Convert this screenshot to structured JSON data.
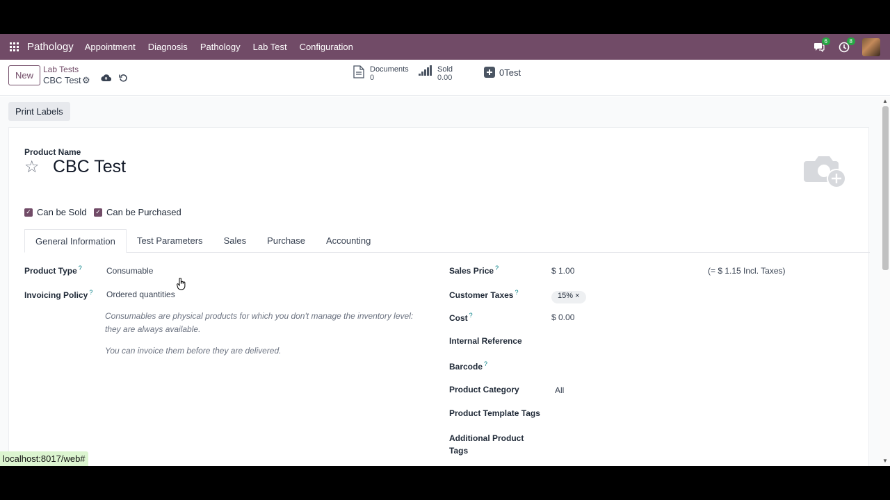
{
  "navbar": {
    "brand": "Pathology",
    "menu": [
      "Appointment",
      "Diagnosis",
      "Pathology",
      "Lab Test",
      "Configuration"
    ],
    "messages_badge": "6",
    "activities_badge": "8"
  },
  "control_panel": {
    "new_label": "New",
    "breadcrumb": "Lab Tests",
    "record_title": "CBC Test",
    "documents": {
      "label": "Documents",
      "value": "0"
    },
    "sold": {
      "label": "Sold",
      "value": "0.00"
    },
    "test_button": "0Test"
  },
  "actions": {
    "print_labels": "Print Labels"
  },
  "form": {
    "product_name_label": "Product Name",
    "product_name": "CBC Test",
    "can_be_sold": "Can be Sold",
    "can_be_purchased": "Can be Purchased",
    "tabs": [
      "General Information",
      "Test Parameters",
      "Sales",
      "Purchase",
      "Accounting"
    ],
    "left": {
      "product_type_label": "Product Type",
      "product_type": "Consumable",
      "invoicing_policy_label": "Invoicing Policy",
      "invoicing_policy": "Ordered quantities",
      "note_1a": "Consumables are physical products for which you don't manage the inventory level:",
      "note_1b": "they are always available.",
      "note_2": "You can invoice them before they are delivered."
    },
    "right": {
      "sales_price_label": "Sales Price",
      "sales_price": "$ 1.00",
      "incl_taxes": "(= $ 1.15 Incl. Taxes)",
      "customer_taxes_label": "Customer Taxes",
      "customer_tax_tag": "15%",
      "cost_label": "Cost",
      "cost": "$ 0.00",
      "internal_reference_label": "Internal Reference",
      "barcode_label": "Barcode",
      "product_category_label": "Product Category",
      "product_category": "All",
      "product_template_tags_label": "Product Template Tags",
      "additional_product_tags_label_1": "Additional Product",
      "additional_product_tags_label_2": "Tags"
    }
  },
  "status_url": "localhost:8017/web#",
  "colors": {
    "brand": "#714b67",
    "accent": "#017e84"
  }
}
